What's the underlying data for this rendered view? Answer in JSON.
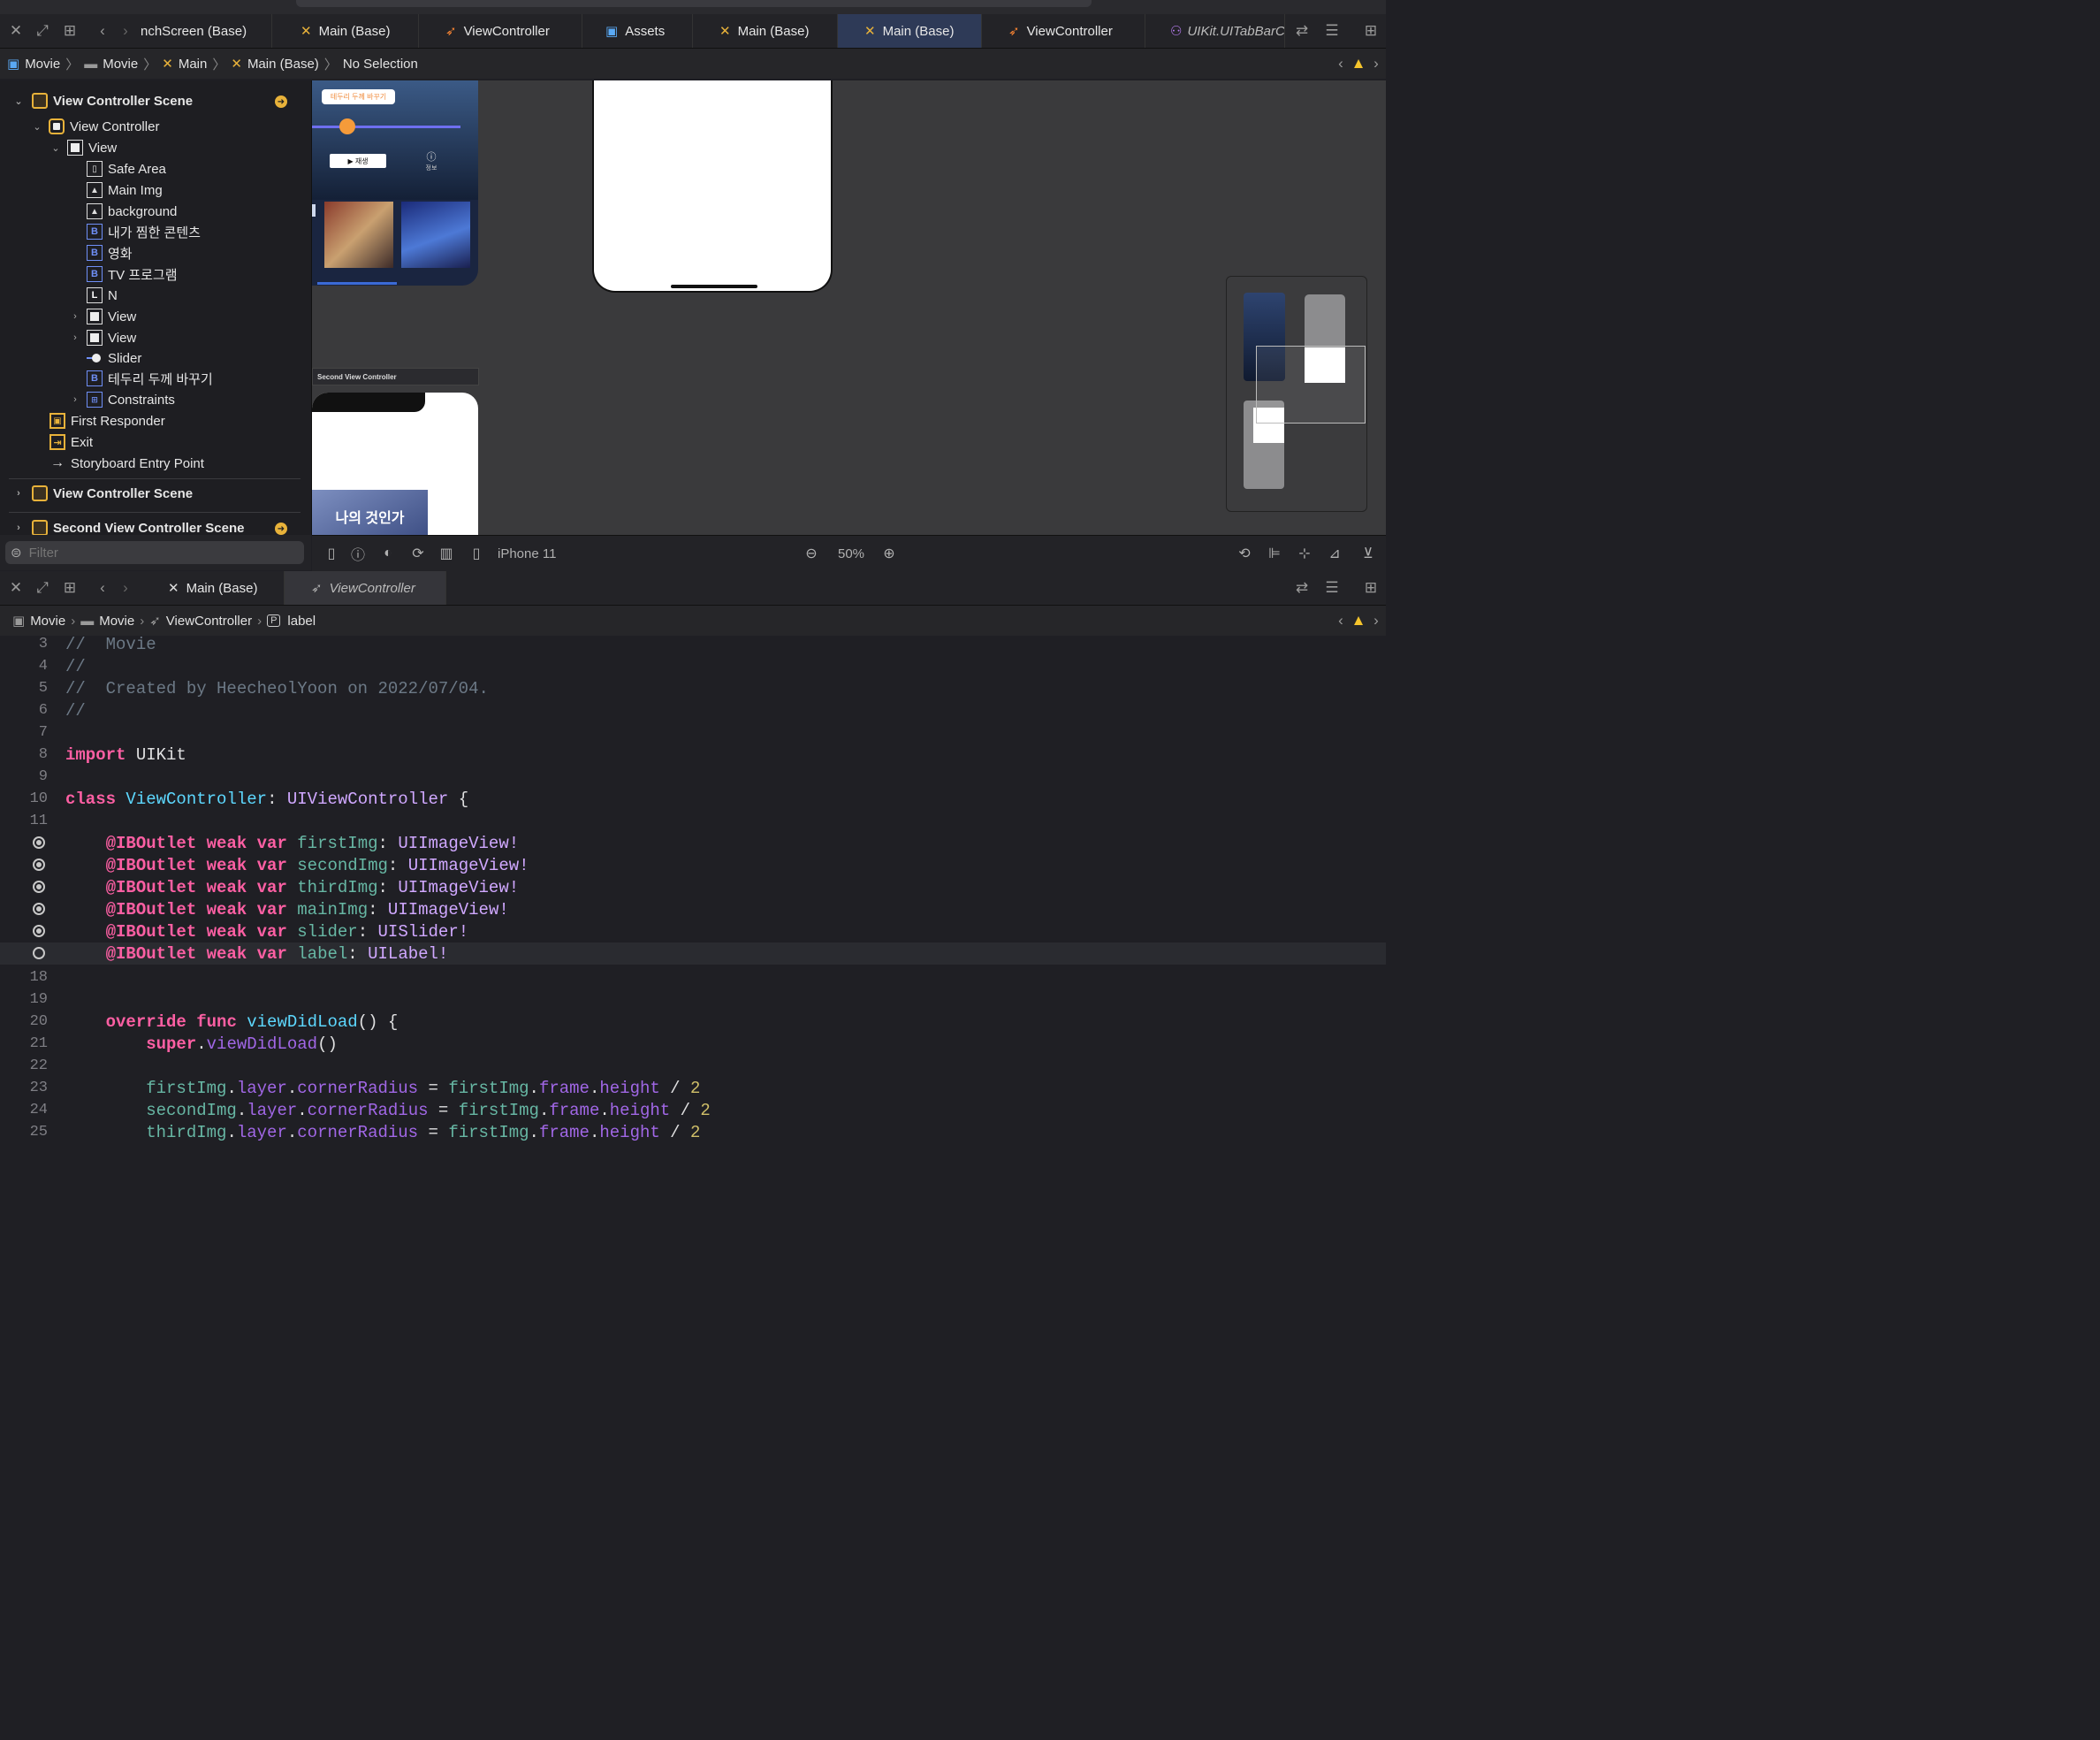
{
  "top_editor": {
    "tabs": [
      {
        "label": "nchScreen (Base)",
        "icon": "storyboard-icon"
      },
      {
        "label": "Main (Base)",
        "icon": "storyboard-icon"
      },
      {
        "label": "ViewController",
        "icon": "swift-icon"
      },
      {
        "label": "Assets",
        "icon": "assets-icon"
      },
      {
        "label": "Main (Base)",
        "icon": "storyboard-icon"
      },
      {
        "label": "Main (Base)",
        "icon": "storyboard-icon",
        "active": true
      },
      {
        "label": "ViewController",
        "icon": "swift-icon"
      },
      {
        "label": "UIKit.UITabBarC",
        "icon": "framework-icon"
      }
    ],
    "breadcrumb": [
      "Movie",
      "Movie",
      "Main",
      "Main (Base)",
      "No Selection"
    ]
  },
  "navigator": {
    "items": [
      {
        "label": "View Controller Scene",
        "type": "scene"
      },
      {
        "label": "View Controller",
        "type": "vc"
      },
      {
        "label": "View",
        "type": "view"
      },
      {
        "label": "Safe Area",
        "type": "safe"
      },
      {
        "label": "Main Img",
        "type": "img"
      },
      {
        "label": "background",
        "type": "img"
      },
      {
        "label": "내가 찜한 콘텐츠",
        "type": "btn"
      },
      {
        "label": "영화",
        "type": "btn"
      },
      {
        "label": "TV 프로그램",
        "type": "btn"
      },
      {
        "label": "N",
        "type": "lbl"
      },
      {
        "label": "View",
        "type": "view"
      },
      {
        "label": "View",
        "type": "view"
      },
      {
        "label": "Slider",
        "type": "slider"
      },
      {
        "label": "테두리 두께 바꾸기",
        "type": "btn"
      },
      {
        "label": "Constraints",
        "type": "cons"
      },
      {
        "label": "First Responder",
        "type": "fr"
      },
      {
        "label": "Exit",
        "type": "exit"
      },
      {
        "label": "Storyboard Entry Point",
        "type": "entry"
      },
      {
        "label": "View Controller Scene",
        "type": "scene"
      },
      {
        "label": "Second View Controller Scene",
        "type": "scene"
      }
    ],
    "filter_placeholder": "Filter"
  },
  "canvas": {
    "button_label": "테두리 두께 바꾸기",
    "play_label": "▶ 재생",
    "info_label": "정보",
    "scene_title": "Second View Controller",
    "poster_text": "나의 것인가"
  },
  "canvas_toolbar": {
    "device": "iPhone 11",
    "zoom": "50%"
  },
  "bottom_editor": {
    "tabs": [
      {
        "label": "Main (Base)",
        "icon": "storyboard-icon"
      },
      {
        "label": "ViewController",
        "icon": "swift-icon",
        "active": true
      }
    ],
    "breadcrumb": [
      "Movie",
      "Movie",
      "ViewController",
      "label"
    ]
  },
  "code": {
    "line_numbers": [
      "3",
      "4",
      "5",
      "6",
      "7",
      "8",
      "9",
      "10",
      "11",
      "",
      "",
      "",
      "",
      "",
      "",
      "18",
      "19",
      "20",
      "21",
      "22",
      "23",
      "24",
      "25"
    ],
    "comment_movie": "//  Movie",
    "comment_empty": "//",
    "comment_created": "//  Created by HeecheolYoon on 2022/07/04.",
    "kw_import": "import",
    "module": "UIKit",
    "kw_class": "class",
    "class_name": "ViewController",
    "superclass": "UIViewController",
    "outlets": [
      {
        "name": "firstImg",
        "type": "UIImageView!"
      },
      {
        "name": "secondImg",
        "type": "UIImageView!"
      },
      {
        "name": "thirdImg",
        "type": "UIImageView!"
      },
      {
        "name": "mainImg",
        "type": "UIImageView!"
      },
      {
        "name": "slider",
        "type": "UISlider!"
      },
      {
        "name": "label",
        "type": "UILabel!"
      }
    ],
    "kw_iboutlet": "@IBOutlet",
    "kw_weak": "weak",
    "kw_var": "var",
    "kw_override": "override",
    "kw_func": "func",
    "func_name": "viewDidLoad",
    "kw_super": "super",
    "corner_lines": [
      "firstImg",
      "secondImg",
      "thirdImg"
    ],
    "layer": "layer",
    "cornerRadius": "cornerRadius",
    "frame": "frame",
    "height": "height",
    "divisor": "2"
  }
}
